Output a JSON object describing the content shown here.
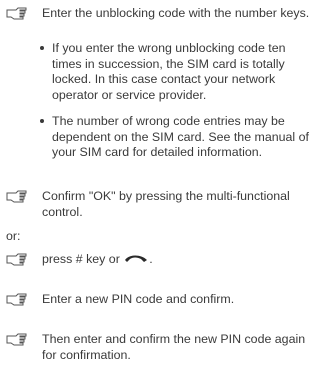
{
  "steps": [
    {
      "text": "Enter the unblocking code with the number keys."
    },
    {
      "text": "Confirm \"OK\" by pressing the multi-functional control."
    },
    {
      "text_before": "press # key or "
    },
    {
      "text": "Enter a new PIN code and confirm."
    },
    {
      "text": "Then enter and confirm the new PIN code again for confirmation."
    }
  ],
  "bullets": [
    {
      "text": "If you enter the wrong unblocking code ten times in succession, the SIM card is totally locked. In this case contact your network operator or service provider."
    },
    {
      "text": "The number of wrong code entries may be dependent on the SIM card. See the manual of your SIM card for detailed information."
    }
  ],
  "or_label": "or:",
  "icons": {
    "step_marker": "pointing-hand-icon",
    "end_call": "end-call-key-icon"
  },
  "colors": {
    "text": "#3a3a3a",
    "background": "#ffffff"
  }
}
